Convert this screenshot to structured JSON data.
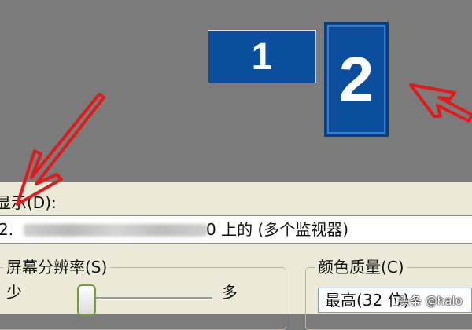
{
  "monitors": [
    {
      "number": "1"
    },
    {
      "number": "2"
    }
  ],
  "display": {
    "label": "显示(D):",
    "selected_number": "2.",
    "selected_suffix": "0 上的 (多个监视器)"
  },
  "resolution": {
    "title": "屏幕分辨率(S)",
    "less_label": "少",
    "more_label": "多"
  },
  "color_quality": {
    "title": "颜色质量(C)",
    "selected": "最高(32 位)"
  },
  "watermark": "头条 @halo",
  "colors": {
    "monitor_blue": "#0b4e9e",
    "arrow_red": "#e11b1b",
    "dialog_bg": "#ece9d8",
    "preview_bg": "#7b7b7b"
  }
}
